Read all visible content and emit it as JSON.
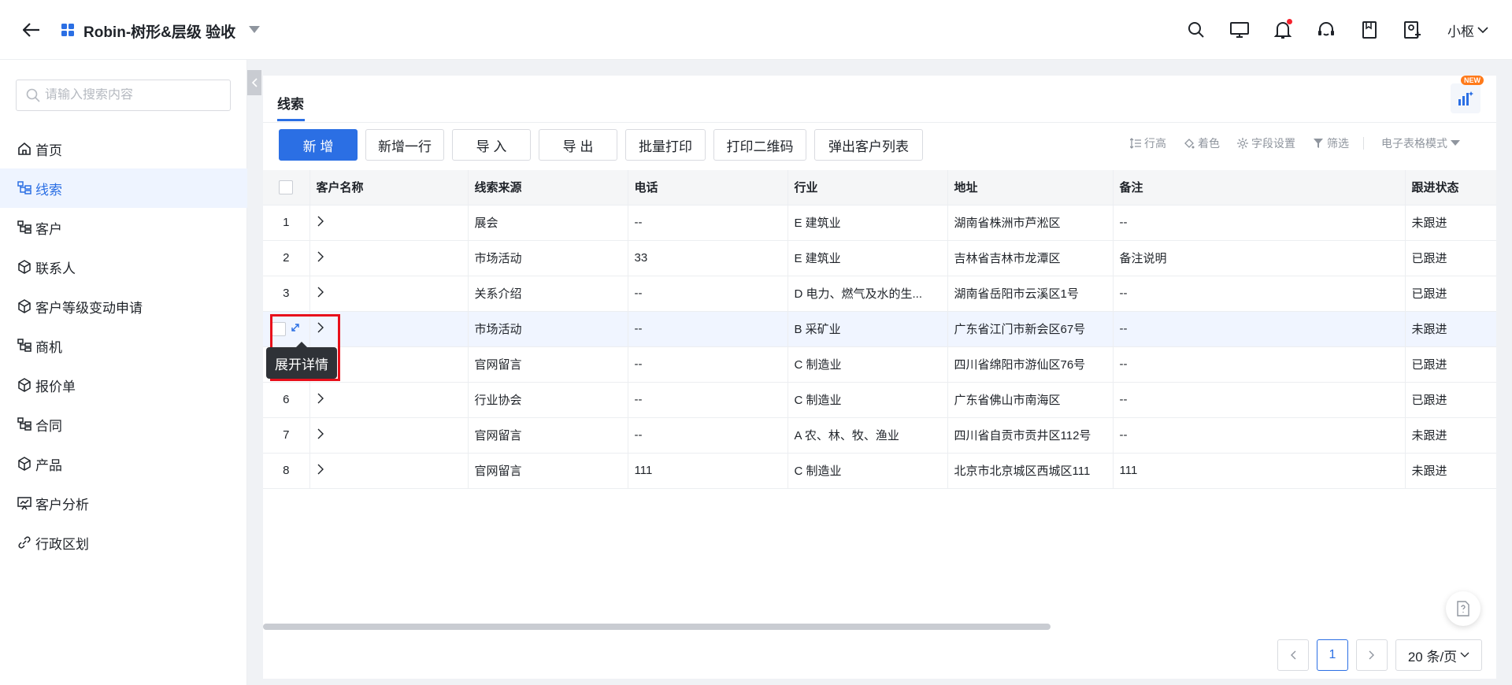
{
  "header": {
    "title": "Robin-树形&层级 验收",
    "user": "小枢"
  },
  "sidebar": {
    "search_placeholder": "请输入搜索内容",
    "items": [
      {
        "label": "首页",
        "icon": "home-icon"
      },
      {
        "label": "线索",
        "icon": "tree-icon",
        "active": true
      },
      {
        "label": "客户",
        "icon": "tree-icon"
      },
      {
        "label": "联系人",
        "icon": "cube-icon"
      },
      {
        "label": "客户等级变动申请",
        "icon": "cube-icon"
      },
      {
        "label": "商机",
        "icon": "tree-icon"
      },
      {
        "label": "报价单",
        "icon": "cube-icon"
      },
      {
        "label": "合同",
        "icon": "tree-icon"
      },
      {
        "label": "产品",
        "icon": "cube-icon"
      },
      {
        "label": "客户分析",
        "icon": "chart-board-icon"
      },
      {
        "label": "行政区划",
        "icon": "link-icon"
      }
    ]
  },
  "tab": {
    "label": "线索",
    "badge": "NEW"
  },
  "toolbar": {
    "buttons": [
      "新 增",
      "新增一行",
      "导 入",
      "导 出",
      "批量打印",
      "打印二维码",
      "弹出客户列表"
    ],
    "tools": [
      "行高",
      "着色",
      "字段设置",
      "筛选"
    ],
    "mode": "电子表格模式"
  },
  "table": {
    "columns": [
      "客户名称",
      "线索来源",
      "电话",
      "行业",
      "地址",
      "备注",
      "跟进状态"
    ],
    "rows": [
      {
        "idx": "1",
        "source": "展会",
        "phone": "--",
        "industry": "E 建筑业",
        "address": "湖南省株洲市芦淞区",
        "note": "--",
        "status": "未跟进"
      },
      {
        "idx": "2",
        "source": "市场活动",
        "phone": "33",
        "industry": "E 建筑业",
        "address": "吉林省吉林市龙潭区",
        "note": "备注说明",
        "status": "已跟进"
      },
      {
        "idx": "3",
        "source": "关系介绍",
        "phone": "--",
        "industry": "D 电力、燃气及水的生...",
        "address": "湖南省岳阳市云溪区1号",
        "note": "--",
        "status": "已跟进"
      },
      {
        "idx": "",
        "source": "市场活动",
        "phone": "--",
        "industry": "B 采矿业",
        "address": "广东省江门市新会区67号",
        "note": "--",
        "status": "未跟进"
      },
      {
        "idx": "",
        "source": "官网留言",
        "phone": "--",
        "industry": "C 制造业",
        "address": "四川省绵阳市游仙区76号",
        "note": "--",
        "status": "已跟进"
      },
      {
        "idx": "6",
        "source": "行业协会",
        "phone": "--",
        "industry": "C 制造业",
        "address": "广东省佛山市南海区",
        "note": "--",
        "status": "已跟进"
      },
      {
        "idx": "7",
        "source": "官网留言",
        "phone": "--",
        "industry": "A 农、林、牧、渔业",
        "address": "四川省自贡市贡井区112号",
        "note": "--",
        "status": "未跟进"
      },
      {
        "idx": "8",
        "source": "官网留言",
        "phone": "111",
        "industry": "C 制造业",
        "address": "北京市北京城区西城区111",
        "note": "111",
        "status": "未跟进"
      }
    ]
  },
  "tooltip": "展开详情",
  "pager": {
    "current": "1",
    "size": "20 条/页"
  },
  "colors": {
    "accent": "#2b6fe4",
    "highlight": "#e8101b"
  }
}
